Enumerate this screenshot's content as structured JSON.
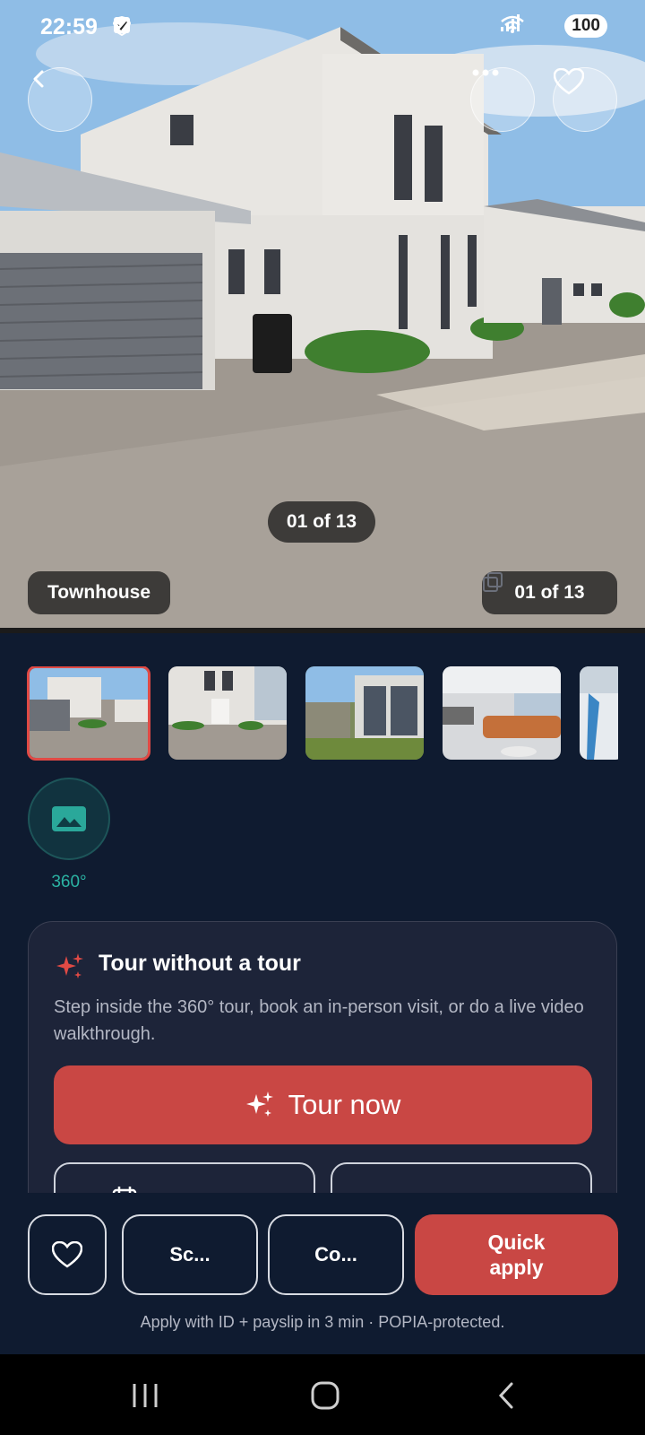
{
  "status_bar": {
    "time": "22:59",
    "battery": "100",
    "icons": [
      "brave-icon",
      "checkbox-icon",
      "check-icon",
      "dot-icon",
      "wifi-icon",
      "signal-icon"
    ]
  },
  "hero": {
    "counter_center": "01 of 13",
    "tag": "Townhouse",
    "counter_right": "01 of 13"
  },
  "gallery": {
    "thumbnails": [
      {
        "alt": "Townhouse exterior front"
      },
      {
        "alt": "Townhouse entrance"
      },
      {
        "alt": "Garden and patio"
      },
      {
        "alt": "Living room"
      },
      {
        "alt": "Bedroom curtain"
      }
    ],
    "pano_label": "360°"
  },
  "tour_card": {
    "title": "Tour without a tour",
    "description": "Step inside the 360° tour, book an in-person visit, or do a live video walkthrough.",
    "tour_button": "Tour now"
  },
  "bottom_bar": {
    "schedule_label": "Sc...",
    "contact_label": "Co...",
    "apply_label": "Quick\napply",
    "note": "Apply with ID + payslip in 3 min · POPIA-protected."
  },
  "colors": {
    "accent": "#c94744",
    "background": "#0f1b30",
    "card": "#1d2439",
    "teal": "#2bb3a3"
  }
}
